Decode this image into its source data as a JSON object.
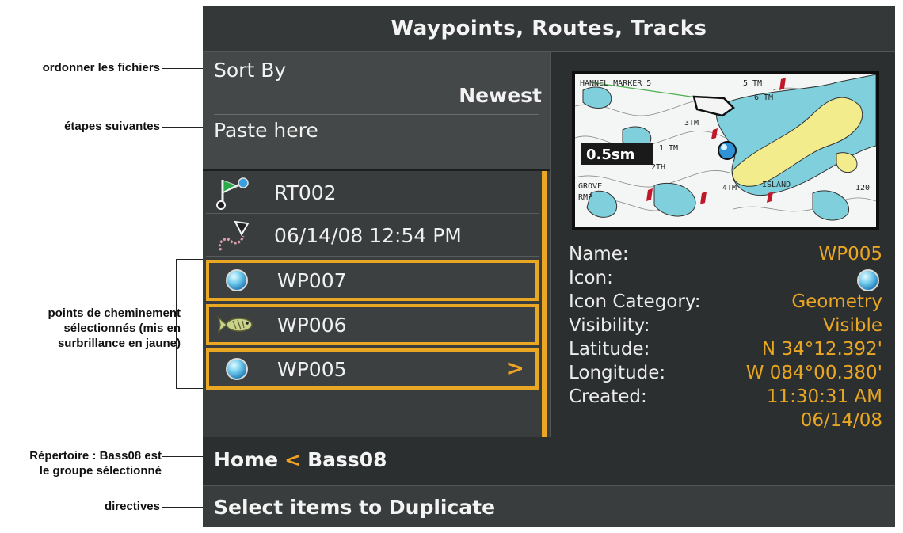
{
  "screen": {
    "title": "Waypoints, Routes, Tracks",
    "sort_label": "Sort By",
    "sort_value": "Newest",
    "paste_label": "Paste here",
    "list_items": [
      {
        "label": "RT002",
        "icon": "route-icon",
        "selected": false
      },
      {
        "label": "06/14/08 12:54 PM",
        "icon": "track-icon",
        "selected": false
      },
      {
        "label": "WP007",
        "icon": "waypoint-orb-icon",
        "selected": true
      },
      {
        "label": "WP006",
        "icon": "fish-icon",
        "selected": true
      },
      {
        "label": "WP005",
        "icon": "waypoint-orb-icon",
        "selected": true,
        "chevron": ">"
      }
    ],
    "map": {
      "labels": [
        "HANNEL MARKER 5",
        "5 TM",
        "6 TM",
        "3TM",
        "1 TM",
        "2TH",
        "4TM",
        "ISLAND",
        "GROVE",
        "RMP",
        "120"
      ],
      "scale": "0.5sm"
    },
    "details": {
      "name_label": "Name:",
      "name_value": "WP005",
      "icon_label": "Icon:",
      "category_label": "Icon Category:",
      "category_value": "Geometry",
      "visibility_label": "Visibility:",
      "visibility_value": "Visible",
      "latitude_label": "Latitude:",
      "latitude_value": "N 34°12.392'",
      "longitude_label": "Longitude:",
      "longitude_value": "W 084°00.380'",
      "created_label": "Created:",
      "created_time": "11:30:31 AM",
      "created_date": "06/14/08"
    },
    "breadcrumb": {
      "home": "Home",
      "separator": "<",
      "group": "Bass08"
    },
    "instructions": "Select items to Duplicate"
  },
  "callouts": {
    "sort": "ordonner les fichiers",
    "paste": "étapes suivantes",
    "selected_line1": "points de cheminement",
    "selected_line2": "sélectionnés (mis en",
    "selected_line3": "surbrillance en jaune)",
    "directory_line1": "Répertoire : Bass08 est",
    "directory_line2": "le groupe sélectionné",
    "instructions": "directives"
  },
  "colors": {
    "highlight": "#e9a723",
    "screen_bg": "#2c2f2f",
    "panel_bg": "#3a3d3d"
  }
}
